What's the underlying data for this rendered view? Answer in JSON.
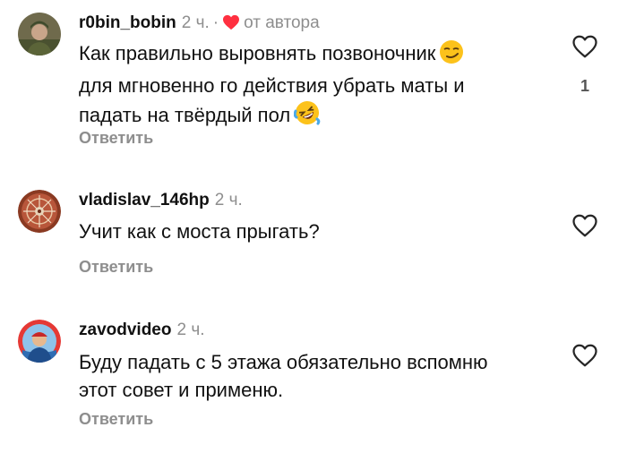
{
  "comments": [
    {
      "username": "r0bin_bobin",
      "time": "2 ч.",
      "separator": "·",
      "author_like_label": "от автора",
      "text_line1": "Как правильно выровнять позвоночник",
      "text_line2": "для мгновенно го действия убрать маты и",
      "text_line3": "падать на твёрдый пол",
      "emoji_1": "smirk-emoji",
      "emoji_2": "rofl-emoji",
      "reply_label": "Ответить",
      "like_count": "1"
    },
    {
      "username": "vladislav_146hp",
      "time": "2 ч.",
      "text_line1": "Учит как с моста прыгать?",
      "reply_label": "Ответить"
    },
    {
      "username": "zavodvideo",
      "time": "2 ч.",
      "text_line1": "Буду падать с 5 этажа обязательно вспомню",
      "text_line2": "этот совет и применю.",
      "reply_label": "Ответить"
    }
  ],
  "colors": {
    "text": "#111111",
    "muted": "#8e8e8e",
    "heart_red": "#ff3040"
  }
}
